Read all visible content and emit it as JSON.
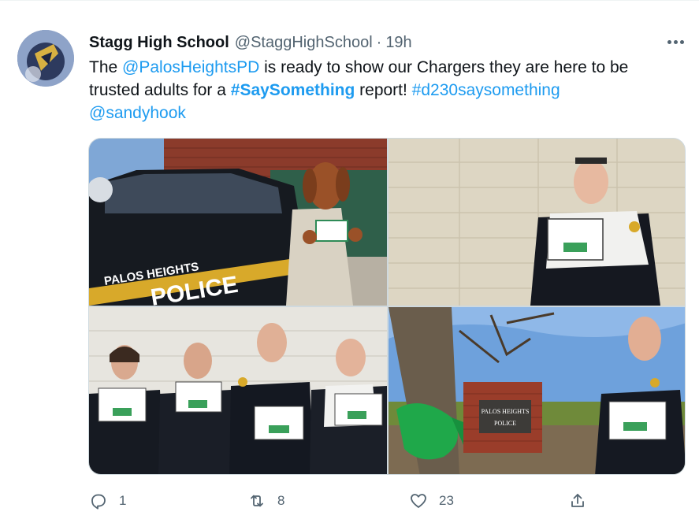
{
  "tweet": {
    "author_name": "Stagg High School",
    "author_handle": "@StaggHighSchool",
    "separator": "·",
    "timestamp": "19h",
    "text": {
      "part1": "The ",
      "mention1": "@PalosHeightsPD",
      "part2": " is ready to show our Chargers they are here to be trusted adults for a ",
      "hashtag_bold": "#SaySomething",
      "part3": " report! ",
      "hashtag2": "#d230saysomething",
      "space": " ",
      "mention2": "@sandyhook"
    }
  },
  "photos": {
    "car_lettering_1": "PALOS HEIGHTS",
    "car_lettering_2": "POLICE",
    "sign_line1": "PALOS HEIGHTS",
    "sign_line2": "POLICE"
  },
  "actions": {
    "reply_count": "1",
    "retweet_count": "8",
    "like_count": "23"
  },
  "icons": {
    "more": "more-icon",
    "reply": "reply-icon",
    "retweet": "retweet-icon",
    "like": "heart-icon",
    "share": "share-icon"
  },
  "colors": {
    "link": "#1d9bf0",
    "secondary_text": "#536471",
    "primary_text": "#0f1419"
  }
}
